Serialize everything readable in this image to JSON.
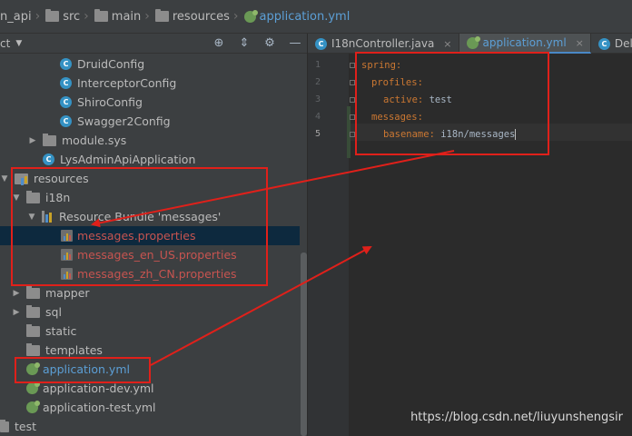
{
  "breadcrumb": {
    "items": [
      {
        "label": "n_api",
        "icon": "folder-icon"
      },
      {
        "label": "src",
        "icon": "folder-icon"
      },
      {
        "label": "main",
        "icon": "folder-icon"
      },
      {
        "label": "resources",
        "icon": "folder-icon"
      },
      {
        "label": "application.yml",
        "icon": "yaml-file-icon"
      }
    ]
  },
  "project_panel": {
    "title": "ct",
    "toolbar_icons": [
      "crosshair-icon",
      "collapse-icon",
      "gear-icon",
      "minimize-icon"
    ]
  },
  "tree": {
    "rows": [
      {
        "label": "DruidConfig",
        "icon": "class-icon",
        "indent": 4
      },
      {
        "label": "InterceptorConfig",
        "icon": "class-icon",
        "indent": 4
      },
      {
        "label": "ShiroConfig",
        "icon": "class-icon",
        "indent": 4
      },
      {
        "label": "Swagger2Config",
        "icon": "class-icon",
        "indent": 4
      },
      {
        "label": "module.sys",
        "icon": "package-icon",
        "expanded": false
      },
      {
        "label": "LysAdminApiApplication",
        "icon": "class-icon"
      },
      {
        "label": "resources",
        "icon": "resources-folder-icon",
        "expanded": true
      },
      {
        "label": "i18n",
        "icon": "folder-icon",
        "expanded": true
      },
      {
        "label": "Resource Bundle 'messages'",
        "icon": "resource-bundle-icon",
        "expanded": true
      },
      {
        "label": "messages.properties",
        "icon": "properties-file-icon",
        "selected": true
      },
      {
        "label": "messages_en_US.properties",
        "icon": "properties-file-icon"
      },
      {
        "label": "messages_zh_CN.properties",
        "icon": "properties-file-icon"
      },
      {
        "label": "mapper",
        "icon": "folder-icon",
        "expanded": false
      },
      {
        "label": "sql",
        "icon": "folder-icon",
        "expanded": false
      },
      {
        "label": "static",
        "icon": "folder-icon"
      },
      {
        "label": "templates",
        "icon": "folder-icon"
      },
      {
        "label": "application.yml",
        "icon": "yaml-file-icon"
      },
      {
        "label": "application-dev.yml",
        "icon": "yaml-file-icon"
      },
      {
        "label": "application-test.yml",
        "icon": "yaml-file-icon"
      },
      {
        "label": "test",
        "icon": "folder-icon"
      }
    ]
  },
  "editor": {
    "tabs": [
      {
        "label": "I18nController.java",
        "icon": "class-icon",
        "active": false
      },
      {
        "label": "application.yml",
        "icon": "yaml-file-icon",
        "active": true
      },
      {
        "label": "Deleg",
        "icon": "class-icon",
        "active": false
      }
    ],
    "tab_close": "×",
    "line_numbers": [
      "1",
      "2",
      "3",
      "4",
      "5"
    ],
    "lines": [
      {
        "key": "spring:",
        "value": ""
      },
      {
        "key": "profiles:",
        "value": ""
      },
      {
        "key": "active:",
        "value": " test"
      },
      {
        "key": "messages:",
        "value": ""
      },
      {
        "key": "basename:",
        "value": " i18n/messages"
      }
    ]
  },
  "watermark": "https://blog.csdn.net/liuyunshengsir",
  "colors": {
    "annotation": "#e0201a",
    "yaml_key": "#cc7832",
    "modified_file": "#c75450",
    "active_file": "#5c9fd6"
  }
}
